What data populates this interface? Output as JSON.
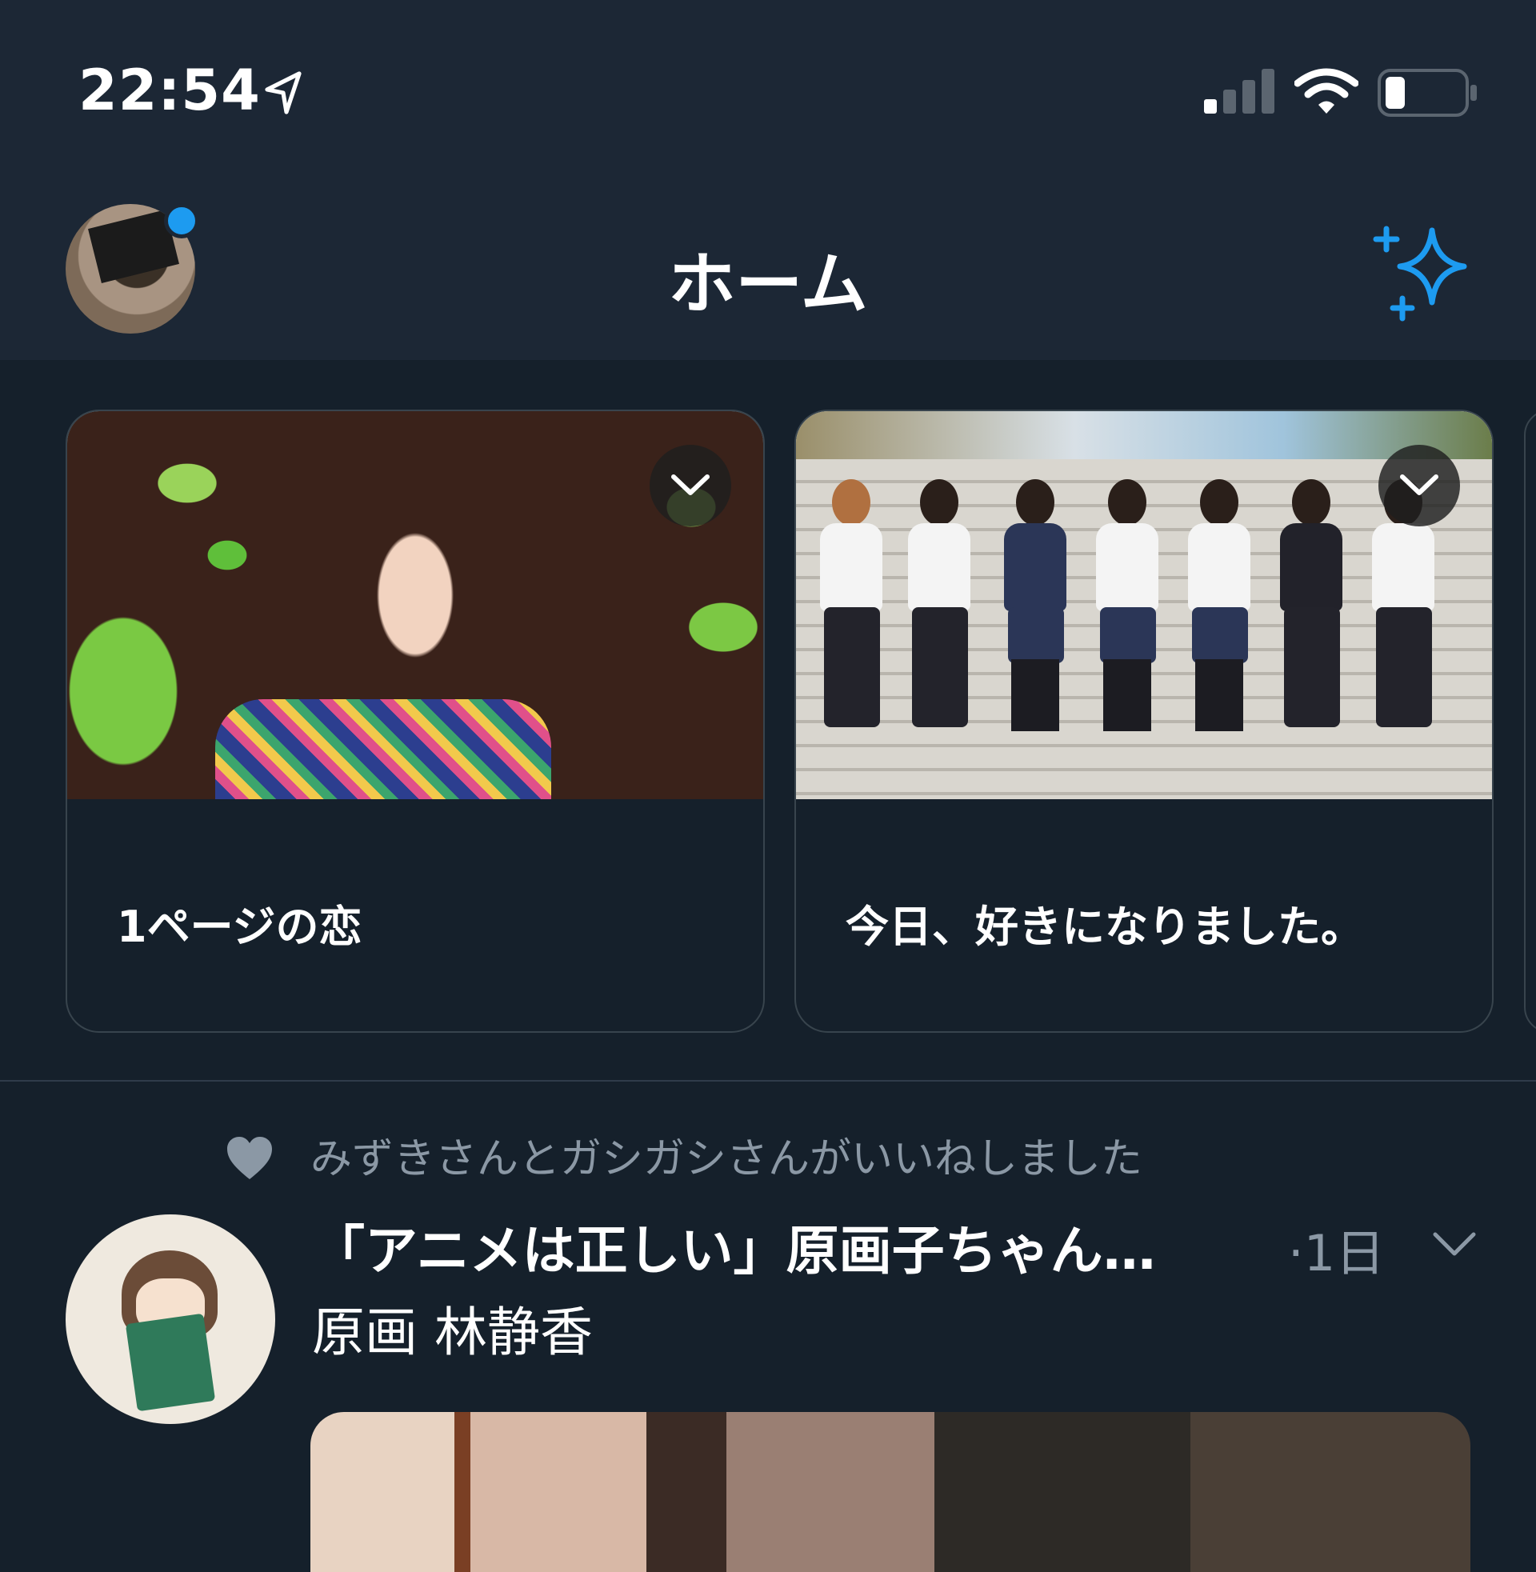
{
  "status_bar": {
    "time": "22:54"
  },
  "nav": {
    "title": "ホーム"
  },
  "cards": [
    {
      "title": "1ページの恋"
    },
    {
      "title": "今日、好きになりました。"
    }
  ],
  "tweet": {
    "social_context": "みずきさんとガシガシさんがいいねしました",
    "author_name": "「アニメは正しい」原画子ちゃん…",
    "time_ago": "·1日",
    "text": "原画 林静香"
  },
  "colors": {
    "background": "#15202b",
    "accent": "#1d9bf0",
    "secondary_text": "#8b98a5"
  }
}
